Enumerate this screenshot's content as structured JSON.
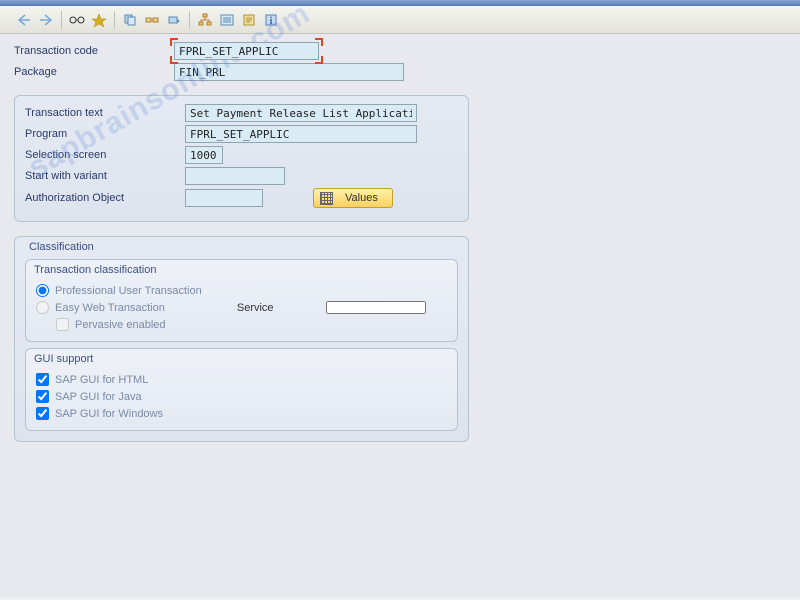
{
  "header": {
    "transaction_code_label": "Transaction code",
    "transaction_code": "FPRL_SET_APPLIC",
    "package_label": "Package",
    "package": "FIN_PRL"
  },
  "details": {
    "transaction_text_label": "Transaction text",
    "transaction_text": "Set Payment Release List Application",
    "program_label": "Program",
    "program": "FPRL_SET_APPLIC",
    "selection_screen_label": "Selection screen",
    "selection_screen": "1000",
    "start_variant_label": "Start with variant",
    "start_variant": "",
    "auth_object_label": "Authorization Object",
    "auth_object": "",
    "values_button": "Values"
  },
  "classification": {
    "title": "Classification",
    "trans_class_title": "Transaction classification",
    "radio_prof": "Professional User Transaction",
    "radio_easy": "Easy Web Transaction",
    "service_label": "Service",
    "service": "",
    "pervasive": "Pervasive enabled",
    "gui_title": "GUI support",
    "gui_html": "SAP GUI for HTML",
    "gui_java": "SAP GUI for Java",
    "gui_windows": "SAP GUI for Windows"
  },
  "watermark": "sapbrainsonline.com"
}
